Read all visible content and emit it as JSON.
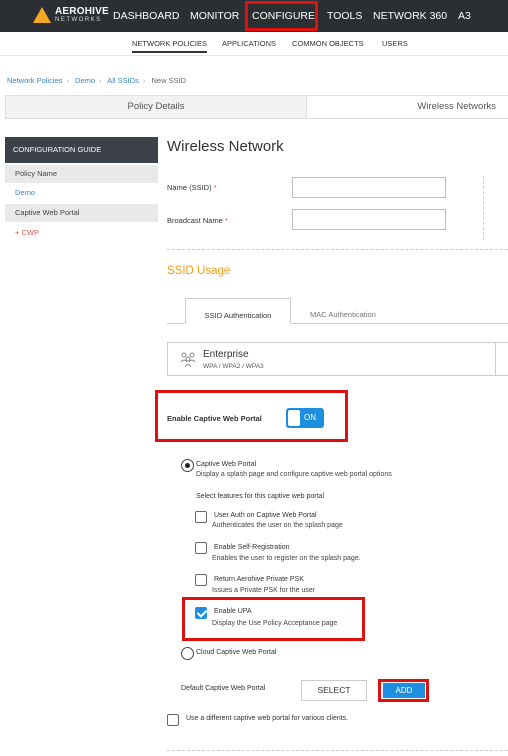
{
  "topnav": {
    "brand": "AEROHIVE",
    "brand_sub": "NETWORKS",
    "items": [
      "DASHBOARD",
      "MONITOR",
      "CONFIGURE",
      "TOOLS",
      "NETWORK 360",
      "A3"
    ]
  },
  "subnav": {
    "items": [
      "NETWORK POLICIES",
      "APPLICATIONS",
      "COMMON OBJECTS",
      "USERS"
    ]
  },
  "breadcrumb": [
    "Network Policies",
    "Demo",
    "All SSIDs",
    "New SSID"
  ],
  "steps": [
    "Policy Details",
    "Wireless Networks"
  ],
  "guide": {
    "header": "CONFIGURATION GUIDE",
    "rows": [
      "Policy Name",
      "Demo",
      "Captive Web Portal",
      "+ CWP"
    ]
  },
  "main": {
    "title": "Wireless Network",
    "name_label": "Name (SSID)",
    "broadcast_label": "Broadcast Name",
    "required_mark": "*",
    "ssid_usage": "SSID Usage",
    "tabs": [
      "SSID Authentication",
      "MAC Authentication"
    ],
    "enterprise_title": "Enterprise",
    "enterprise_sub": "WPA / WPA2 / WPA3",
    "cwp_toggle_label": "Enable Captive Web Portal",
    "cwp_toggle_state": "ON",
    "cwp_radio_title": "Captive Web Portal",
    "cwp_radio_desc": "Display a splash page and configure captive web portal options",
    "features_label": "Select features for this captive web portal",
    "options": [
      {
        "title": "User Auth on Captive Web Portal",
        "desc": "Authenticates the user on the splash page",
        "checked": false
      },
      {
        "title": "Enable Self-Registration",
        "desc": "Enables the user to register on the splash page.",
        "checked": false
      },
      {
        "title": "Return Aerohive Private PSK",
        "desc": "Issues a Private PSK for the user",
        "checked": false
      },
      {
        "title": "Enable UPA",
        "desc": "Display the Use Policy Acceptance page",
        "checked": true
      }
    ],
    "cloud_radio": "Cloud Captive Web Portal",
    "default_label": "Default Captive Web Portal",
    "select_btn": "SELECT",
    "add_btn": "ADD",
    "different_label": "Use a different captive web portal for various clients."
  },
  "colors": {
    "accent": "#1d8fe1",
    "highlight": "#e01010",
    "section": "#f39c12",
    "nav_bg": "#2b2f33"
  }
}
